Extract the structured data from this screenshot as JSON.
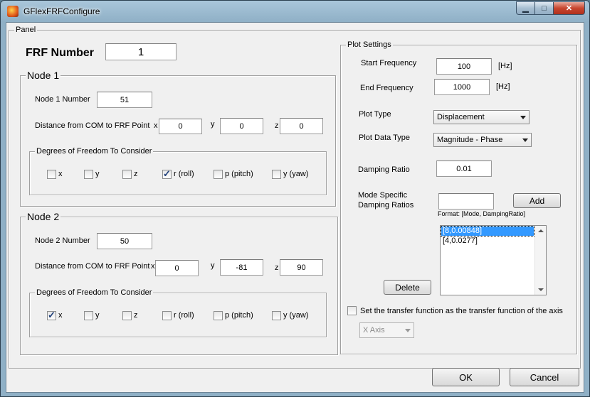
{
  "window": {
    "title": "GFlexFRFConfigure",
    "caption": {
      "minimize": "▁",
      "maximize": "□",
      "close": "✕"
    }
  },
  "panel": {
    "label": "Panel"
  },
  "frf": {
    "label": "FRF Number",
    "value": "1"
  },
  "node1": {
    "group_label": "Node 1",
    "number_label": "Node 1 Number",
    "number_value": "51",
    "distance_label": "Distance from COM to FRF Point",
    "x_label": "x",
    "x_value": "0",
    "y_label": "y",
    "y_value": "0",
    "z_label": "z",
    "z_value": "0",
    "dof_label": "Degrees of Freedom To Consider",
    "dof": [
      {
        "label": "x",
        "checked": false
      },
      {
        "label": "y",
        "checked": false
      },
      {
        "label": "z",
        "checked": false
      },
      {
        "label": "r (roll)",
        "checked": true
      },
      {
        "label": "p  (pitch)",
        "checked": false
      },
      {
        "label": "y (yaw)",
        "checked": false
      }
    ]
  },
  "node2": {
    "group_label": "Node 2",
    "number_label": "Node 2 Number",
    "number_value": "50",
    "distance_label": "Distance from COM to FRF Point",
    "x_label": "x",
    "x_value": "0",
    "y_label": "y",
    "y_value": "-81",
    "z_label": "z",
    "z_value": "90",
    "dof_label": "Degrees of Freedom To Consider",
    "dof": [
      {
        "label": "x",
        "checked": true
      },
      {
        "label": "y",
        "checked": false
      },
      {
        "label": "z",
        "checked": false
      },
      {
        "label": "r (roll)",
        "checked": false
      },
      {
        "label": "p  (pitch)",
        "checked": false
      },
      {
        "label": "y (yaw)",
        "checked": false
      }
    ]
  },
  "plot": {
    "group_label": "Plot Settings",
    "start_label": "Start Frequency",
    "start_value": "100",
    "start_unit": "[Hz]",
    "end_label": "End Frequency",
    "end_value": "1000",
    "end_unit": "[Hz]",
    "type_label": "Plot Type",
    "type_value": "Displacement",
    "data_type_label": "Plot Data Type",
    "data_type_value": "Magnitude - Phase",
    "damping_label": "Damping Ratio",
    "damping_value": "0.01",
    "mode_label_1": "Mode Specific",
    "mode_label_2": "Damping Ratios",
    "mode_value": "",
    "add_label": "Add",
    "format_label": "Format: [Mode, DampingRatio]",
    "list_items": [
      "[8,0.00848]",
      "[4,0.0277]"
    ],
    "delete_label": "Delete",
    "transfer_label": "Set the transfer function as the transfer function of the axis",
    "transfer_checked": false,
    "axis_value": "X Axis"
  },
  "buttons": {
    "ok": "OK",
    "cancel": "Cancel"
  }
}
